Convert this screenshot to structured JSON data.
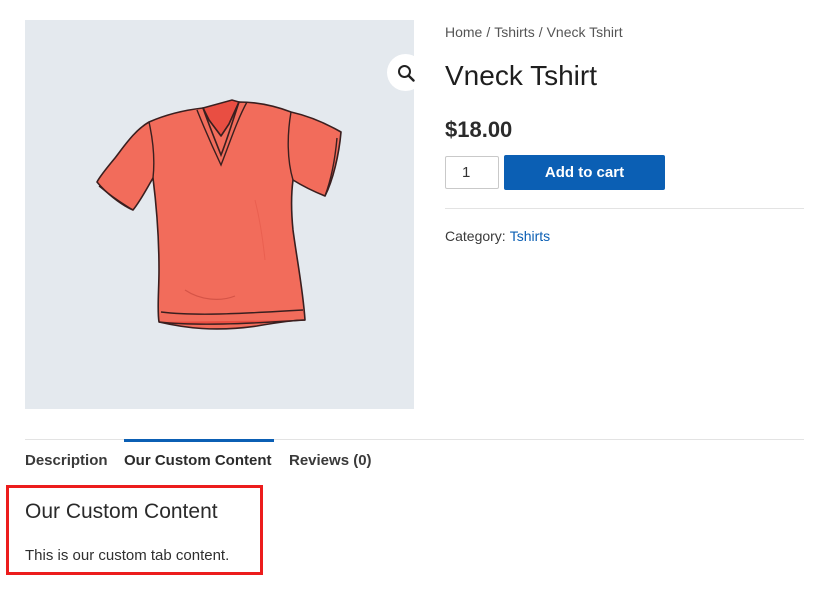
{
  "product": {
    "image_alt": "Vneck Tshirt",
    "shirt_color": "#f26c5b",
    "zoom_icon": "magnifier-icon",
    "title": "Vneck Tshirt",
    "price": "$18.00",
    "quantity": "1",
    "add_to_cart_label": "Add to cart",
    "category_label": "Category:",
    "category_link": "Tshirts"
  },
  "breadcrumb": {
    "items": [
      "Home",
      "Tshirts",
      "Vneck Tshirt"
    ],
    "separator": "/"
  },
  "tabs": {
    "items": [
      {
        "label": "Description",
        "active": false
      },
      {
        "label": "Our Custom Content",
        "active": true
      },
      {
        "label": "Reviews (0)",
        "active": false
      }
    ]
  },
  "panel": {
    "heading": "Our Custom Content",
    "text": "This is our custom tab content."
  },
  "colors": {
    "accent": "#0b5fb4",
    "highlight": "#ec1c1c",
    "image_bg": "#e4e9ee"
  }
}
